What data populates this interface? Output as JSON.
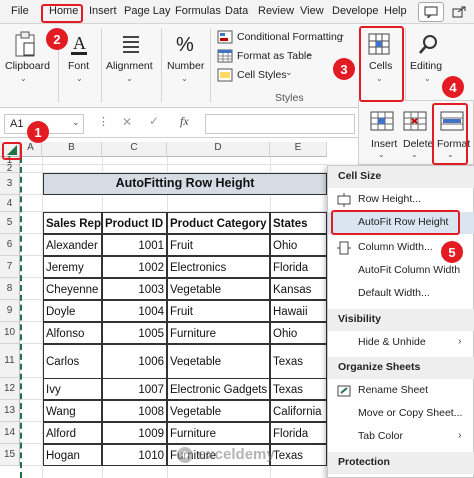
{
  "tabs": [
    "File",
    "Home",
    "Insert",
    "Page Lay",
    "Formulas",
    "Data",
    "Review",
    "View",
    "Develope",
    "Help"
  ],
  "ribbon": {
    "clipboard": "Clipboard",
    "font": "Font",
    "alignment": "Alignment",
    "number": "Number",
    "conditional_formatting": "Conditional Formatting",
    "format_as_table": "Format as Table",
    "cell_styles": "Cell Styles",
    "styles_group": "Styles",
    "cells": "Cells",
    "editing": "Editing",
    "insert": "Insert",
    "delete": "Delete",
    "format": "Format"
  },
  "formula_bar": {
    "name_box": "A1",
    "fx": "fx"
  },
  "columns": [
    "A",
    "B",
    "C",
    "D",
    "E"
  ],
  "rows": [
    "1",
    "2",
    "3",
    "4",
    "5",
    "6",
    "7",
    "8",
    "9",
    "10",
    "11",
    "12",
    "13",
    "14",
    "15"
  ],
  "table": {
    "title": "AutoFitting Row Height",
    "headers": [
      "Sales Rep",
      "Product ID",
      "Product Category",
      "States"
    ],
    "rows": [
      [
        "Alexander",
        "1001",
        "Fruit",
        "Ohio"
      ],
      [
        "Jeremy",
        "1002",
        "Electronics",
        "Florida"
      ],
      [
        "Cheyenne",
        "1003",
        "Vegetable",
        "Kansas"
      ],
      [
        "Doyle",
        "1004",
        "Fruit",
        "Hawaii"
      ],
      [
        "Alfonso",
        "1005",
        "Furniture",
        "Ohio"
      ],
      [
        "Carlos",
        "1006",
        "Vegetable",
        "Texas"
      ],
      [
        "Ivy",
        "1007",
        "Electronic Gadgets",
        "Texas"
      ],
      [
        "Wang",
        "1008",
        "Vegetable",
        "California"
      ],
      [
        "Alford",
        "1009",
        "Furniture",
        "Florida"
      ],
      [
        "Hogan",
        "1010",
        "Furniture",
        "Texas"
      ]
    ]
  },
  "menu": {
    "cell_size": "Cell Size",
    "row_height": "Row Height...",
    "autofit_row_height": "AutoFit Row Height",
    "column_width": "Column Width...",
    "autofit_column_width": "AutoFit Column Width",
    "default_width": "Default Width...",
    "visibility": "Visibility",
    "hide_unhide": "Hide & Unhide",
    "organize_sheets": "Organize Sheets",
    "rename_sheet": "Rename Sheet",
    "move_copy_sheet": "Move or Copy Sheet...",
    "tab_color": "Tab Color",
    "protection": "Protection"
  },
  "badges": [
    "1",
    "2",
    "3",
    "4",
    "5"
  ],
  "watermark": "exceldemy",
  "colors": {
    "accent_red": "#e31b23",
    "excel_green": "#217346",
    "title_fill": "#d6dce4"
  }
}
